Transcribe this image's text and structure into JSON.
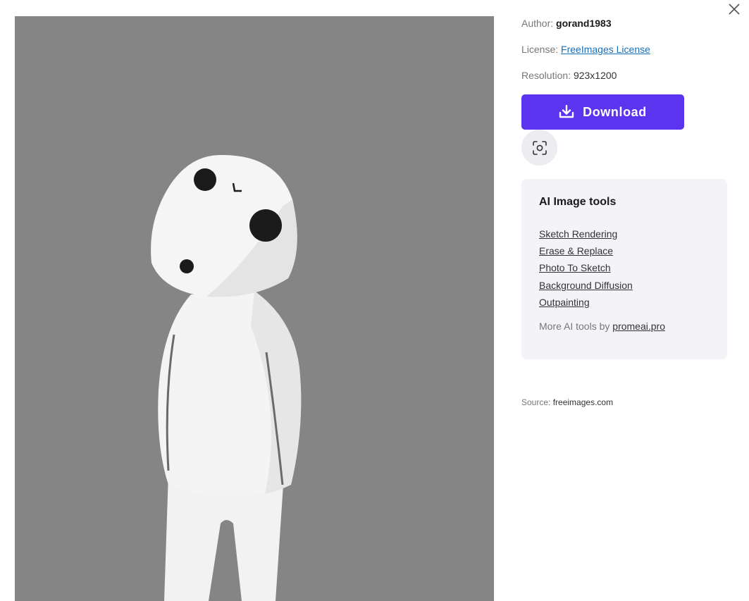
{
  "meta": {
    "author_label": "Author:",
    "author": "gorand1983",
    "license_label": "License:",
    "license": "FreeImages License",
    "resolution_label": "Resolution:",
    "resolution": "923x1200"
  },
  "actions": {
    "download_label": "Download"
  },
  "tools": {
    "title": "AI Image tools",
    "links": [
      "Sketch Rendering",
      "Erase & Replace",
      "Photo To Sketch",
      "Background Diffusion",
      "Outpainting"
    ],
    "more_prefix": "More AI tools by",
    "more_link": "promeai.pro"
  },
  "source": {
    "label": "Source:",
    "value": "freeimages.com"
  },
  "colors": {
    "accent": "#5b34f0",
    "preview_background": "#858585",
    "tools_card_background": "#f4f4f8"
  },
  "icons": {
    "close": "close-icon",
    "download": "download-icon",
    "scan": "scan-icon"
  }
}
